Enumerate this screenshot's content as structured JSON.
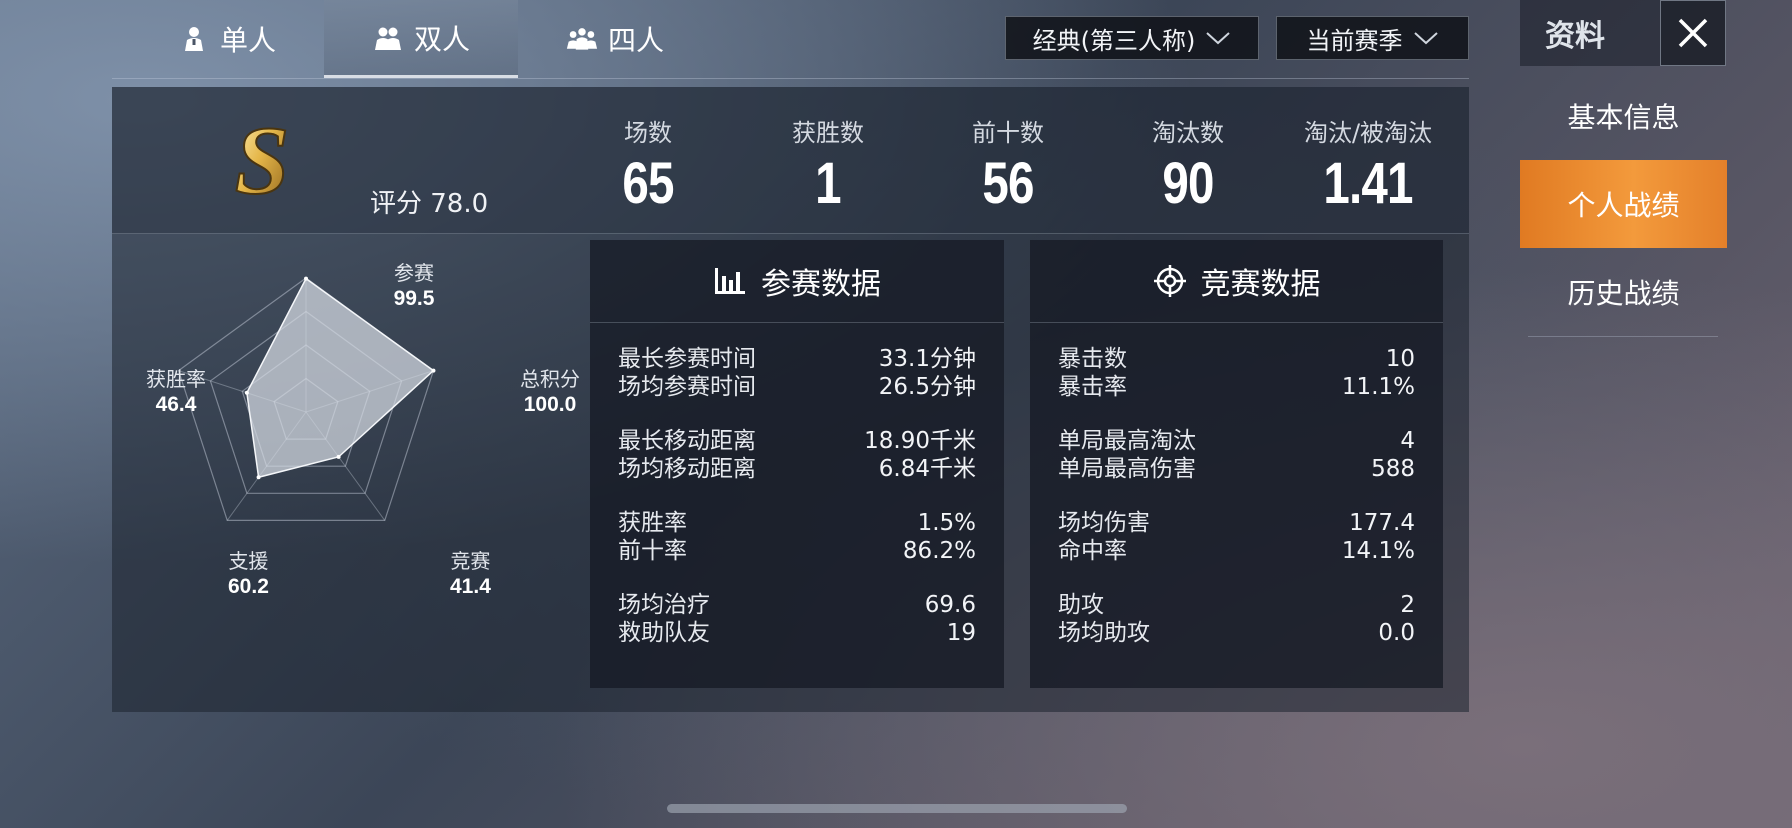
{
  "mode_tabs": [
    {
      "label": "单人",
      "icon": "solo-person-icon"
    },
    {
      "label": "双人",
      "icon": "duo-person-icon",
      "active": true
    },
    {
      "label": "四人",
      "icon": "squad-person-icon"
    }
  ],
  "dropdowns": {
    "mode": "经典(第三人称)",
    "season": "当前赛季"
  },
  "side_panel": {
    "title": "资料",
    "menu": [
      {
        "label": "基本信息"
      },
      {
        "label": "个人战绩",
        "active": true
      },
      {
        "label": "历史战绩"
      }
    ]
  },
  "summary": {
    "rank_letter": "S",
    "rating_label": "评分 78.0",
    "stats": [
      {
        "label": "场数",
        "value": "65"
      },
      {
        "label": "获胜数",
        "value": "1"
      },
      {
        "label": "前十数",
        "value": "56"
      },
      {
        "label": "淘汰数",
        "value": "90"
      },
      {
        "label": "淘汰/被淘汰",
        "value": "1.41"
      }
    ]
  },
  "radar": {
    "max": 100,
    "axes": [
      {
        "label": "参赛",
        "value": "99.5",
        "v": 99.5
      },
      {
        "label": "总积分",
        "value": "100.0",
        "v": 100.0
      },
      {
        "label": "竞赛",
        "value": "41.4",
        "v": 41.4
      },
      {
        "label": "支援",
        "value": "60.2",
        "v": 60.2
      },
      {
        "label": "获胜率",
        "value": "46.4",
        "v": 46.4
      }
    ]
  },
  "participation": {
    "title": "参赛数据",
    "icon": "bar-chart-icon",
    "groups": [
      [
        {
          "k": "最长参赛时间",
          "v": "33.1分钟"
        },
        {
          "k": "场均参赛时间",
          "v": "26.5分钟"
        }
      ],
      [
        {
          "k": "最长移动距离",
          "v": "18.90千米"
        },
        {
          "k": "场均移动距离",
          "v": "6.84千米"
        }
      ],
      [
        {
          "k": "获胜率",
          "v": "1.5%"
        },
        {
          "k": "前十率",
          "v": "86.2%"
        }
      ],
      [
        {
          "k": "场均治疗",
          "v": "69.6"
        },
        {
          "k": "救助队友",
          "v": "19"
        }
      ]
    ]
  },
  "combat": {
    "title": "竞赛数据",
    "icon": "crosshair-icon",
    "groups": [
      [
        {
          "k": "暴击数",
          "v": "10"
        },
        {
          "k": "暴击率",
          "v": "11.1%"
        }
      ],
      [
        {
          "k": "单局最高淘汰",
          "v": "4"
        },
        {
          "k": "单局最高伤害",
          "v": "588"
        }
      ],
      [
        {
          "k": "场均伤害",
          "v": "177.4"
        },
        {
          "k": "命中率",
          "v": "14.1%"
        }
      ],
      [
        {
          "k": "助攻",
          "v": "2"
        },
        {
          "k": "场均助攻",
          "v": "0.0"
        }
      ]
    ]
  }
}
